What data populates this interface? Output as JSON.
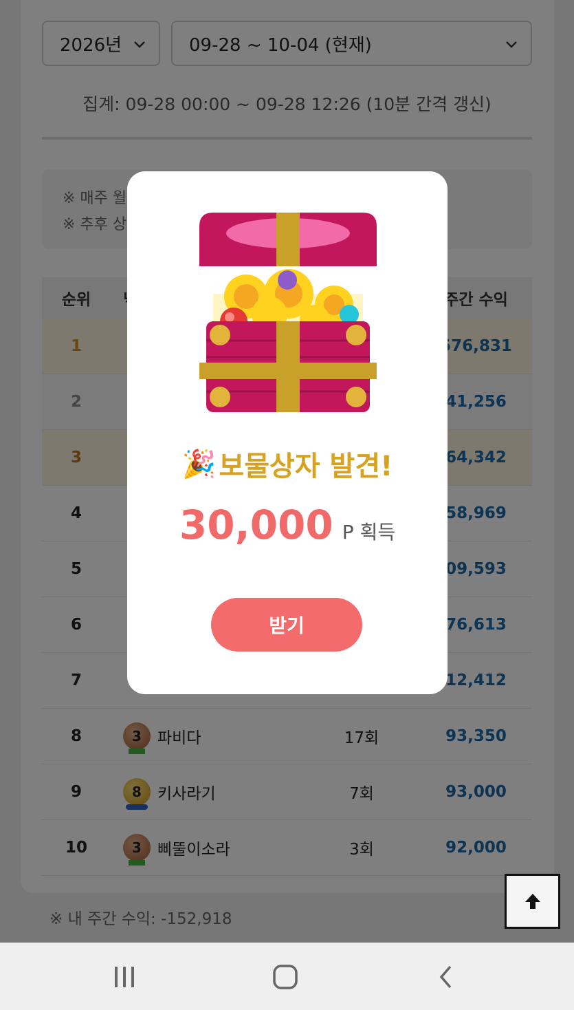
{
  "filters": {
    "year": "2026년",
    "week": "09-28 ~ 10-04 (현재)"
  },
  "aggregation": "집계: 09-28 00:00 ~ 09-28 12:26 (10분 간격 갱신)",
  "notices": [
    "※ 매주 월",
    "※ 추후 상"
  ],
  "table": {
    "headers": {
      "rank": "순위",
      "nick": "닉",
      "payout": "주간 수익"
    },
    "rows": [
      {
        "rank": "1",
        "badge": "",
        "nick": "",
        "count": "",
        "payout": "576,831"
      },
      {
        "rank": "2",
        "badge": "",
        "nick": "",
        "count": "",
        "payout": "41,256"
      },
      {
        "rank": "3",
        "badge": "",
        "nick": "",
        "count": "",
        "payout": "64,342"
      },
      {
        "rank": "4",
        "badge": "",
        "nick": "",
        "count": "",
        "payout": "58,969"
      },
      {
        "rank": "5",
        "badge": "",
        "nick": "",
        "count": "",
        "payout": "09,593"
      },
      {
        "rank": "6",
        "badge": "",
        "nick": "",
        "count": "",
        "payout": "76,613"
      },
      {
        "rank": "7",
        "badge": "",
        "nick": "",
        "count": "",
        "payout": "12,412"
      },
      {
        "rank": "8",
        "badge": "3",
        "nick": "파비다",
        "count": "17회",
        "payout": "93,350"
      },
      {
        "rank": "9",
        "badge": "8",
        "nick": "키사라기",
        "count": "7회",
        "payout": "93,000"
      },
      {
        "rank": "10",
        "badge": "3",
        "nick": "삐뚤이소라",
        "count": "3회",
        "payout": "92,000"
      }
    ]
  },
  "my_payout": "※ 내 주간 수익: -152,918",
  "modal": {
    "emoji": "🎉",
    "title": "보물상자 발견!",
    "amount": "30,000",
    "unit": "P 획득",
    "button": "받기"
  },
  "colors": {
    "accent_red": "#f36b6b",
    "title_gold": "#d7a21f",
    "payout_blue": "#1d68a7"
  },
  "icons": {
    "scroll_top": "arrow-up-icon",
    "nav_recent": "recent-apps-icon",
    "nav_home": "home-icon",
    "nav_back": "back-icon"
  }
}
